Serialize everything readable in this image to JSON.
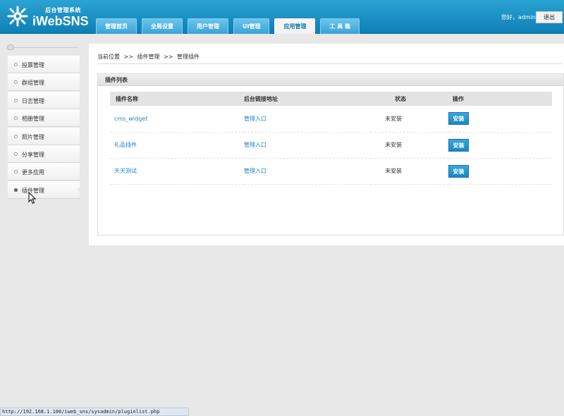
{
  "header": {
    "logo_subtitle": "后台管理系统",
    "logo_name": "iWebSNS",
    "greeting": "您好，admin",
    "logout_label": "退出"
  },
  "nav": {
    "tabs": [
      {
        "label": "管理首页"
      },
      {
        "label": "全局设置"
      },
      {
        "label": "用户管理"
      },
      {
        "label": "UI管理"
      },
      {
        "label": "应用管理"
      },
      {
        "label": "工 具 箱"
      }
    ],
    "active_index": 4
  },
  "sidebar": {
    "items": [
      {
        "label": "投票管理"
      },
      {
        "label": "群组管理"
      },
      {
        "label": "日志管理"
      },
      {
        "label": "相册管理"
      },
      {
        "label": "照片管理"
      },
      {
        "label": "分享管理"
      },
      {
        "label": "更多应用"
      },
      {
        "label": "插件管理"
      }
    ],
    "active_index": 7
  },
  "breadcrumb": {
    "items": [
      "当前位置",
      "插件管理",
      "管理插件"
    ],
    "separator": ">>"
  },
  "panel": {
    "title": "插件列表",
    "columns": [
      "插件名称",
      "后台链接地址",
      "状态",
      "操作"
    ],
    "rows": [
      {
        "name": "cms_widget",
        "link": "管理入口",
        "status": "未安装",
        "action": "安装"
      },
      {
        "name": "礼品插件",
        "link": "管理入口",
        "status": "未安装",
        "action": "安装"
      },
      {
        "name": "天天测试",
        "link": "管理入口",
        "status": "未安装",
        "action": "安装"
      }
    ]
  },
  "statusbar": {
    "url": "http://192.168.1.106/iweb_sns/sysadmin/pluginlist.php"
  },
  "colors": {
    "header_blue": "#1a8fc4",
    "link_blue": "#1e86c4",
    "button_blue": "#2596cf"
  }
}
